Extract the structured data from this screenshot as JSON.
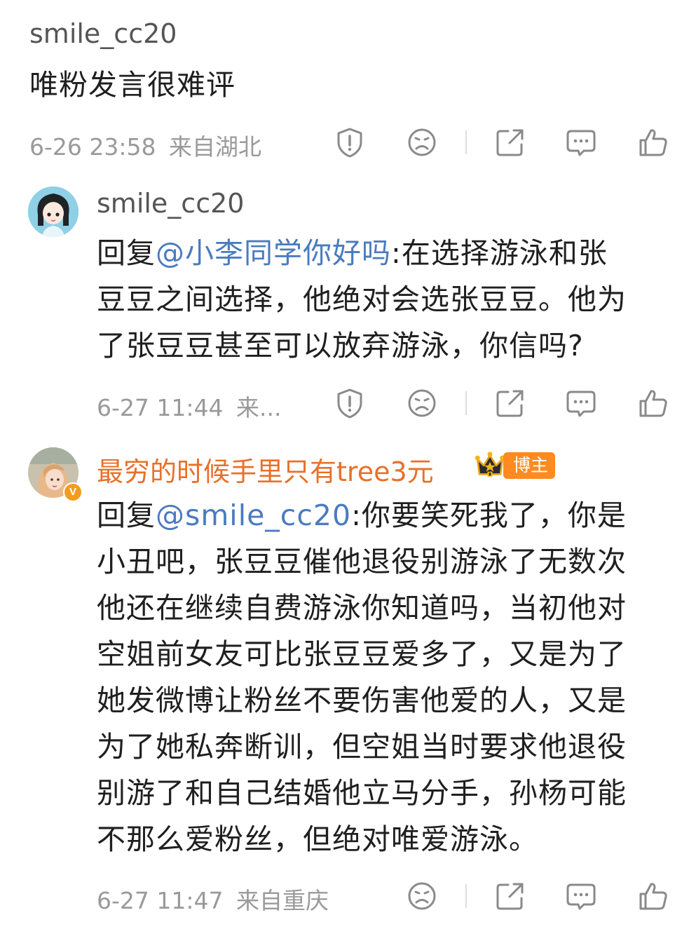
{
  "comments": [
    {
      "username": "smile_cc20",
      "text": "唯粉发言很难评",
      "timestamp": "6-26 23:58",
      "location": "来自湖北"
    },
    {
      "username": "smile_cc20",
      "reply_prefix": "回复",
      "mention": "@小李同学你好吗",
      "text_lines": [
        ":在选择游泳和张",
        "豆豆之间选择，他绝对会选张豆豆。他为",
        "了张豆豆甚至可以放弃游泳，你信吗?"
      ],
      "timestamp": "6-27 11:44",
      "location": "来..."
    },
    {
      "username": "最穷的时候手里只有tree3元",
      "blogger_tag": "博主",
      "badge": "V",
      "reply_prefix": "回复",
      "mention": "@smile_cc20",
      "text_lines": [
        ":你要笑死我了，你是",
        "小丑吧，张豆豆催他退役别游泳了无数次",
        "他还在继续自费游泳你知道吗，当初他对",
        "空姐前女友可比张豆豆爱多了，又是为了",
        "她发微博让粉丝不要伤害他爱的人，又是",
        "为了她私奔断训，但空姐当时要求他退役",
        "别游了和自己结婚他立马分手，孙杨可能",
        "不那么爱粉丝，但绝对唯爱游泳。"
      ],
      "timestamp": "6-27 11:47",
      "location": "来自重庆"
    }
  ],
  "icons": {
    "report": "report-icon",
    "dislike": "sad-face-icon",
    "share": "share-icon",
    "comment": "comment-icon",
    "like": "thumbs-up-icon"
  },
  "colors": {
    "mention": "#4a7bbf",
    "blogger_name": "#e8702a",
    "meta": "#9a9a9a",
    "icon": "#8a8a8a"
  }
}
